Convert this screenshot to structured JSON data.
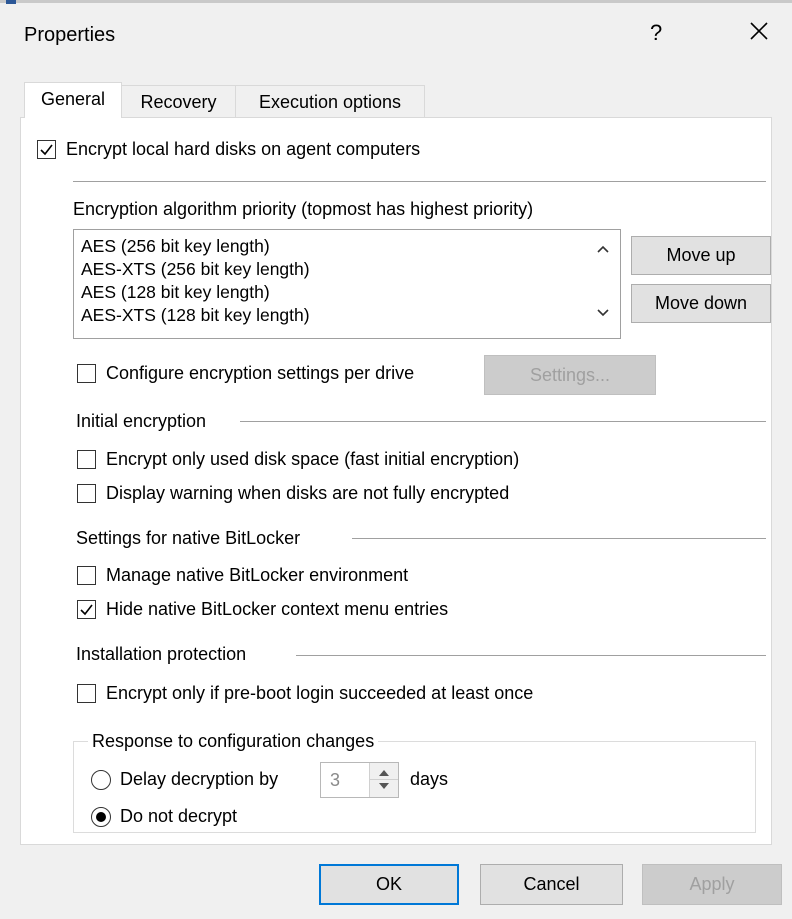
{
  "window": {
    "title": "Properties",
    "help_label": "?",
    "close_icon": "close-icon"
  },
  "tabs": [
    {
      "label": "General",
      "active": true
    },
    {
      "label": "Recovery",
      "active": false
    },
    {
      "label": "Execution options",
      "active": false
    }
  ],
  "general": {
    "encrypt_local": {
      "label": "Encrypt local hard disks on agent computers",
      "checked": true
    },
    "algorithm_heading": "Encryption algorithm priority (topmost has highest priority)",
    "algorithms": [
      "AES (256 bit key length)",
      "AES-XTS (256 bit key length)",
      "AES (128 bit key length)",
      "AES-XTS (128 bit key length)"
    ],
    "move_up_label": "Move up",
    "move_down_label": "Move down",
    "per_drive": {
      "label": "Configure encryption settings per drive",
      "checked": false
    },
    "settings_button": "Settings...",
    "initial_encryption": {
      "heading": "Initial encryption",
      "used_space": {
        "label": "Encrypt only used disk space (fast initial encryption)",
        "checked": false
      },
      "display_warning": {
        "label": "Display warning when disks are not fully encrypted",
        "checked": false
      }
    },
    "bitlocker": {
      "heading": "Settings for native BitLocker",
      "manage_env": {
        "label": "Manage native BitLocker environment",
        "checked": false
      },
      "hide_menu": {
        "label": "Hide native BitLocker context menu entries",
        "checked": true
      }
    },
    "installation_protection": {
      "heading": "Installation protection",
      "preboot": {
        "label": "Encrypt only if pre-boot login succeeded at least once",
        "checked": false
      },
      "response": {
        "title": "Response to configuration changes",
        "delay_label": "Delay decryption by",
        "delay_value": "3",
        "days_label": "days",
        "no_decrypt_label": "Do not decrypt",
        "selected": "Do not decrypt"
      }
    }
  },
  "footer": {
    "ok_label": "OK",
    "cancel_label": "Cancel",
    "apply_label": "Apply"
  }
}
